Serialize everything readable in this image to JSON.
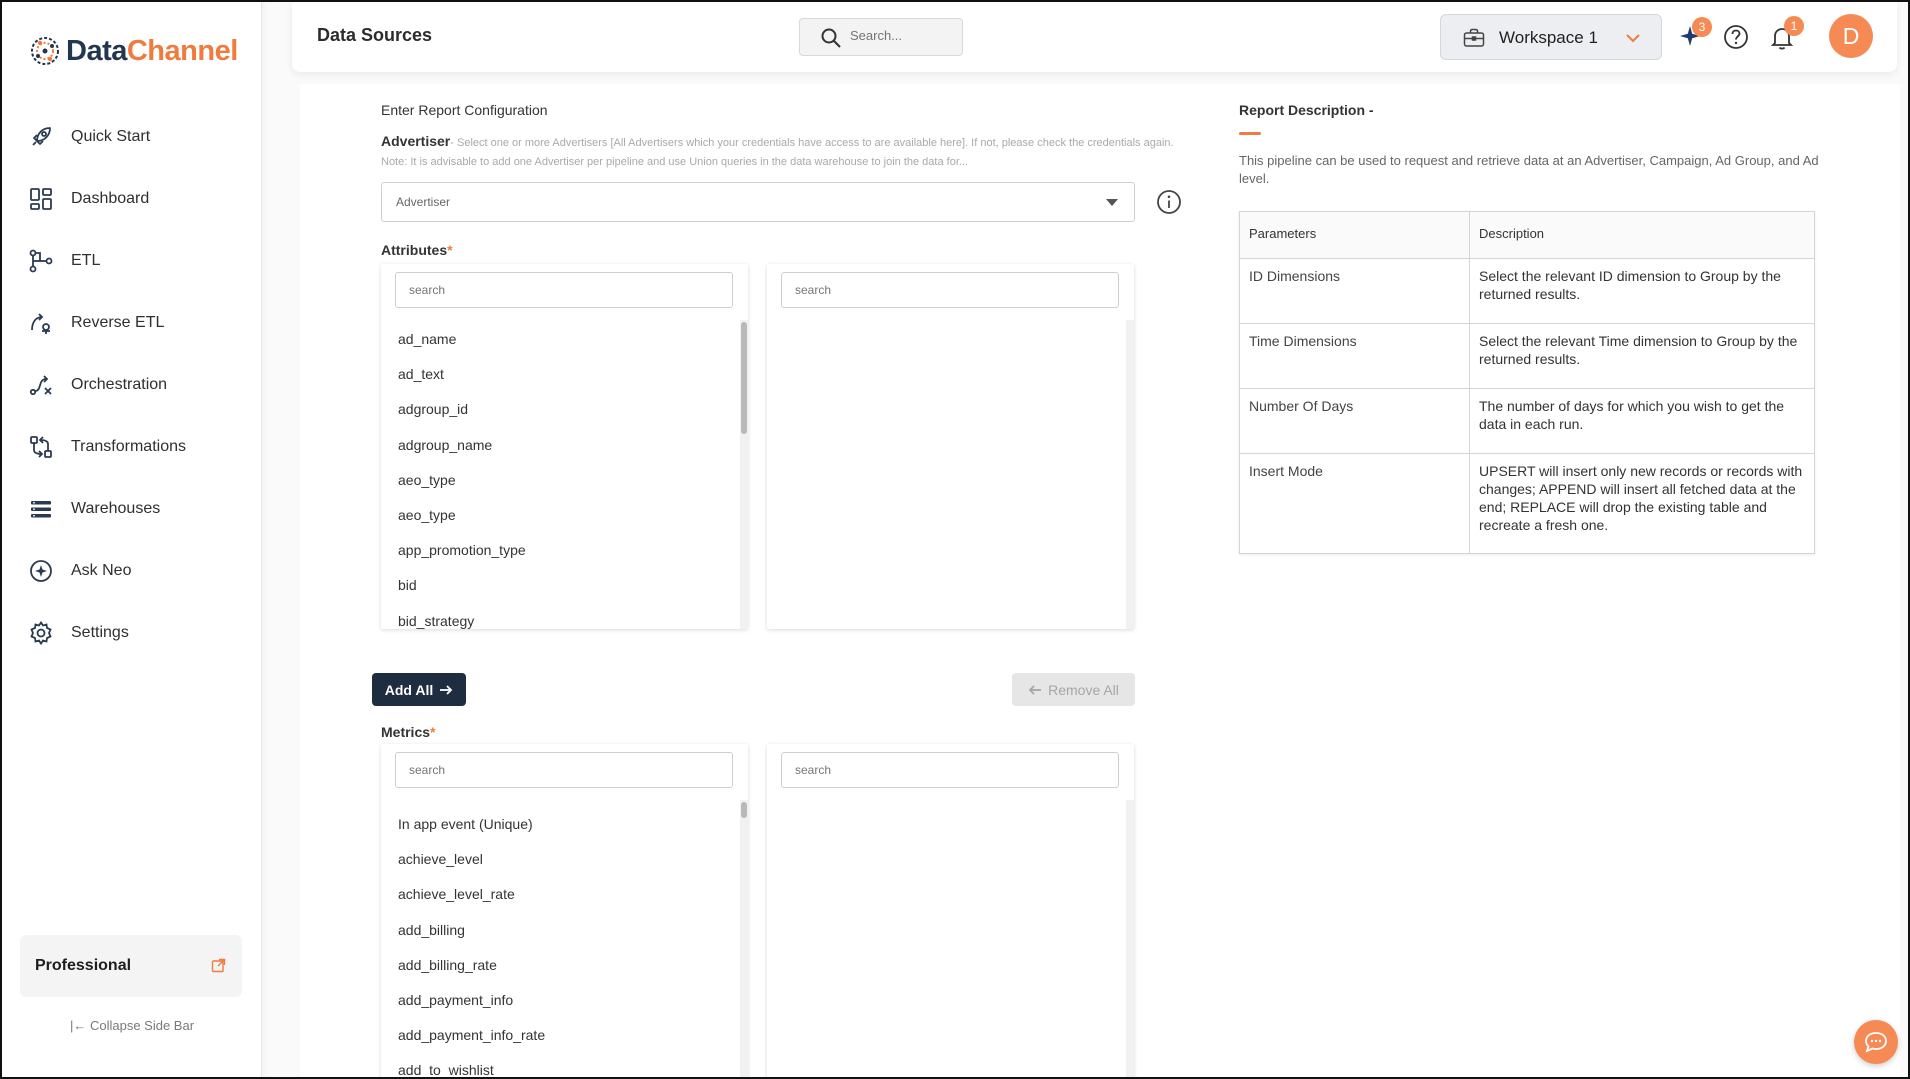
{
  "brand": {
    "name_part1": "Data",
    "name_part2": "Channel",
    "primary_color": "#22364f",
    "accent_color": "#f07b3f"
  },
  "sidebar": {
    "items": [
      {
        "label": "Quick Start",
        "icon": "rocket-icon"
      },
      {
        "label": "Dashboard",
        "icon": "dashboard-icon"
      },
      {
        "label": "ETL",
        "icon": "etl-icon"
      },
      {
        "label": "Reverse ETL",
        "icon": "reverse-etl-icon"
      },
      {
        "label": "Orchestration",
        "icon": "orchestration-icon"
      },
      {
        "label": "Transformations",
        "icon": "transformations-icon"
      },
      {
        "label": "Warehouses",
        "icon": "warehouses-icon"
      },
      {
        "label": "Ask Neo",
        "icon": "ask-neo-icon"
      },
      {
        "label": "Settings",
        "icon": "gear-icon"
      }
    ],
    "plan": "Professional",
    "collapse_label": "Collapse Side Bar"
  },
  "header": {
    "title": "Data Sources",
    "search_placeholder": "Search...",
    "workspace": "Workspace 1",
    "ai_badge": "3",
    "notification_badge": "1",
    "avatar_initial": "D"
  },
  "config": {
    "section_title": "Enter Report Configuration",
    "advertiser_label": "Advertiser",
    "advertiser_help": "- Select one or more Advertisers [All Advertisers which your credentials have access to are available here]. If not, please check the credentials again. Note: It is advisable to add one Advertiser per pipeline and use Union queries in the data warehouse to join the data for...",
    "advertiser_placeholder": "Advertiser",
    "attributes_label": "Attributes",
    "required_mark": "*",
    "search_placeholder": "search",
    "attributes": [
      "ad_name",
      "ad_text",
      "adgroup_id",
      "adgroup_name",
      "aeo_type",
      "aeo_type",
      "app_promotion_type",
      "bid",
      "bid_strategy"
    ],
    "add_all_label": "Add All",
    "remove_all_label": "Remove All",
    "metrics_label": "Metrics",
    "metrics": [
      "In app event (Unique)",
      "achieve_level",
      "achieve_level_rate",
      "add_billing",
      "add_billing_rate",
      "add_payment_info",
      "add_payment_info_rate",
      "add_to_wishlist"
    ]
  },
  "report": {
    "title": "Report Description -",
    "description": "This pipeline can be used to request and retrieve data at an Advertiser, Campaign, Ad Group, and Ad level.",
    "table_headers": [
      "Parameters",
      "Description"
    ],
    "rows": [
      {
        "param": "ID Dimensions",
        "desc": "Select the relevant ID dimension to Group by the returned results."
      },
      {
        "param": "Time Dimensions",
        "desc": "Select the relevant Time dimension to Group by the returned results."
      },
      {
        "param": "Number Of Days",
        "desc": "The number of days for which you wish to get the data in each run."
      },
      {
        "param": "Insert Mode",
        "desc": "UPSERT will insert only new records or records with changes; APPEND will insert all fetched data at the end; REPLACE will drop the existing table and recreate a fresh one."
      }
    ]
  }
}
